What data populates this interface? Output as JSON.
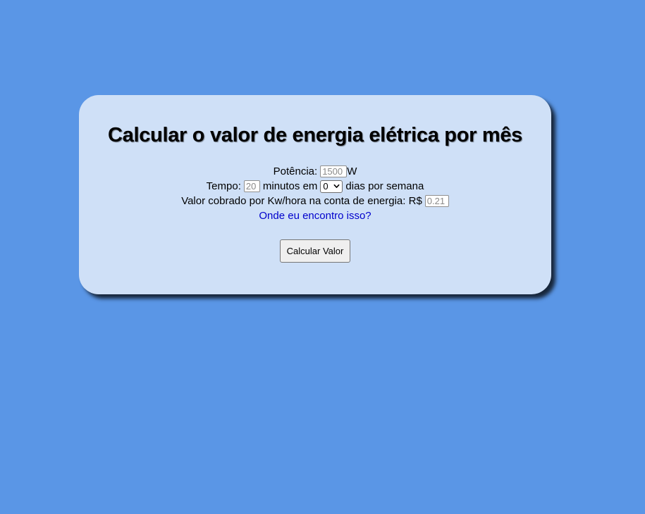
{
  "card": {
    "title": "Calcular o valor de energia elétrica por mês"
  },
  "form": {
    "potencia_label": "Potência:",
    "potencia_placeholder": "1500",
    "potencia_unit": "W",
    "tempo_label": "Tempo:",
    "tempo_placeholder": "20",
    "tempo_mid": "minutos em",
    "dias_selected": "0",
    "dias_suffix": "dias por semana",
    "valor_label": "Valor cobrado por Kw/hora na conta de energia: R$",
    "valor_placeholder": "0.21",
    "help_link": "Onde eu encontro isso?",
    "submit_label": "Calcular Valor"
  },
  "colors": {
    "page_background": "#5a96e6",
    "card_background": "#cfe0f7",
    "link": "#0000cc"
  }
}
